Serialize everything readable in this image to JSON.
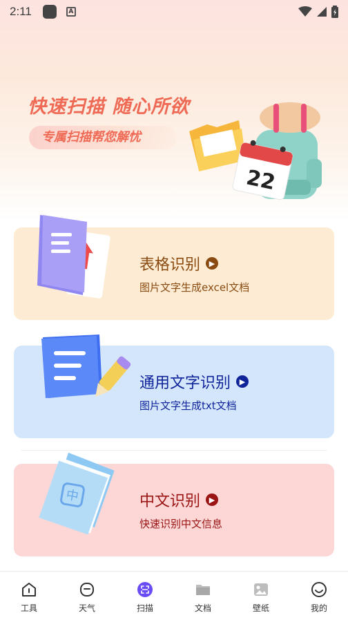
{
  "status_bar": {
    "time": "2:11",
    "a_badge": "A"
  },
  "banner": {
    "title": "快速扫描 随心所欲",
    "subtitle": "专属扫描帮您解忧",
    "calendar_day": "22"
  },
  "cards": [
    {
      "title": "表格识别",
      "subtitle": "图片文字生成excel文档",
      "accent": "#8a4b12",
      "bg": "#fdecd3"
    },
    {
      "title": "通用文字识别",
      "subtitle": "图片文字生成txt文档",
      "accent": "#10249a",
      "bg": "#d4e6fb"
    },
    {
      "title": "中文识别",
      "subtitle": "快速识别中文信息",
      "accent": "#9a1414",
      "bg": "#fcd7d6",
      "icon_char": "中"
    }
  ],
  "bottom_nav": {
    "active_index": 2,
    "active_color": "#6a4cf5",
    "items": [
      {
        "label": "工具",
        "icon": "home-icon"
      },
      {
        "label": "天气",
        "icon": "weather-icon"
      },
      {
        "label": "扫描",
        "icon": "scan-icon"
      },
      {
        "label": "文档",
        "icon": "folder-icon"
      },
      {
        "label": "壁纸",
        "icon": "image-icon"
      },
      {
        "label": "我的",
        "icon": "smiley-icon"
      }
    ]
  }
}
